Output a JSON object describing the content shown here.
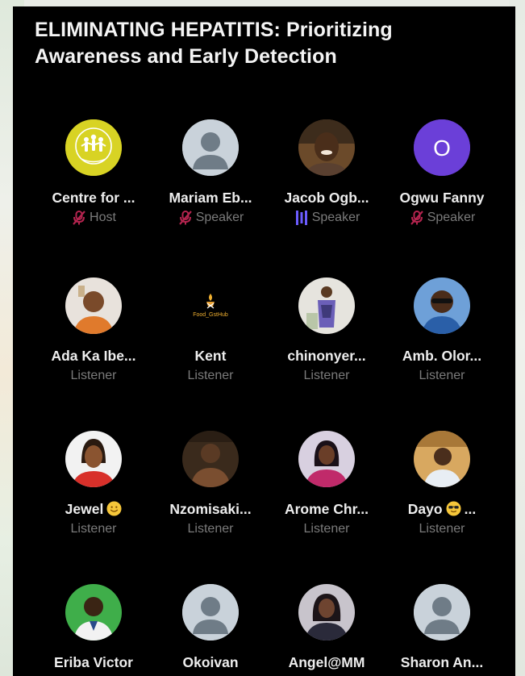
{
  "space": {
    "title": "ELIMINATING HEPATITIS: Prioritizing Awareness and Early Detection"
  },
  "participants": [
    {
      "name": "Centre for ...",
      "role": "Host",
      "role_icon": "mic-off-icon",
      "avatar": "logo-avatar"
    },
    {
      "name": "Mariam Eb...",
      "role": "Speaker",
      "role_icon": "mic-off-icon",
      "avatar": "default-avatar"
    },
    {
      "name": "Jacob Ogb...",
      "role": "Speaker",
      "role_icon": "speaking-bars-icon",
      "avatar": "photo-avatar"
    },
    {
      "name": "Ogwu Fanny",
      "role": "Speaker",
      "role_icon": "mic-off-icon",
      "avatar": "initial-avatar",
      "initial": "O"
    },
    {
      "name": "Ada Ka Ibe...",
      "role": "Listener",
      "avatar": "photo-avatar"
    },
    {
      "name": "Kent",
      "role": "Listener",
      "avatar": "logo-avatar",
      "logo_text": "Food_GstHub"
    },
    {
      "name": "chinonyer...",
      "role": "Listener",
      "avatar": "photo-avatar"
    },
    {
      "name": "Amb. Olor...",
      "role": "Listener",
      "avatar": "photo-avatar"
    },
    {
      "name": "Jewel",
      "name_emoji": "smiling-face-emoji",
      "role": "Listener",
      "avatar": "photo-avatar"
    },
    {
      "name": "Nzomisaki...",
      "role": "Listener",
      "avatar": "photo-avatar"
    },
    {
      "name": "Arome Chr...",
      "role": "Listener",
      "avatar": "photo-avatar"
    },
    {
      "name": "Dayo",
      "name_emoji": "sunglasses-face-emoji",
      "name_suffix": "...",
      "role": "Listener",
      "avatar": "photo-avatar"
    },
    {
      "name": "Eriba Victor",
      "role": "",
      "avatar": "photo-avatar"
    },
    {
      "name": "Okoivan",
      "role": "",
      "avatar": "default-avatar"
    },
    {
      "name": "Angel@MM",
      "role": "",
      "avatar": "photo-avatar"
    },
    {
      "name": "Sharon An...",
      "role": "",
      "avatar": "default-avatar"
    }
  ],
  "colors": {
    "background": "#000000",
    "mic_off": "#b5244f",
    "speaking_bars": "#6b5cff",
    "initial_avatar": "#6b3fd8",
    "default_avatar_bg": "#c9d2da",
    "logo_avatar_bg": "#d8d324"
  }
}
